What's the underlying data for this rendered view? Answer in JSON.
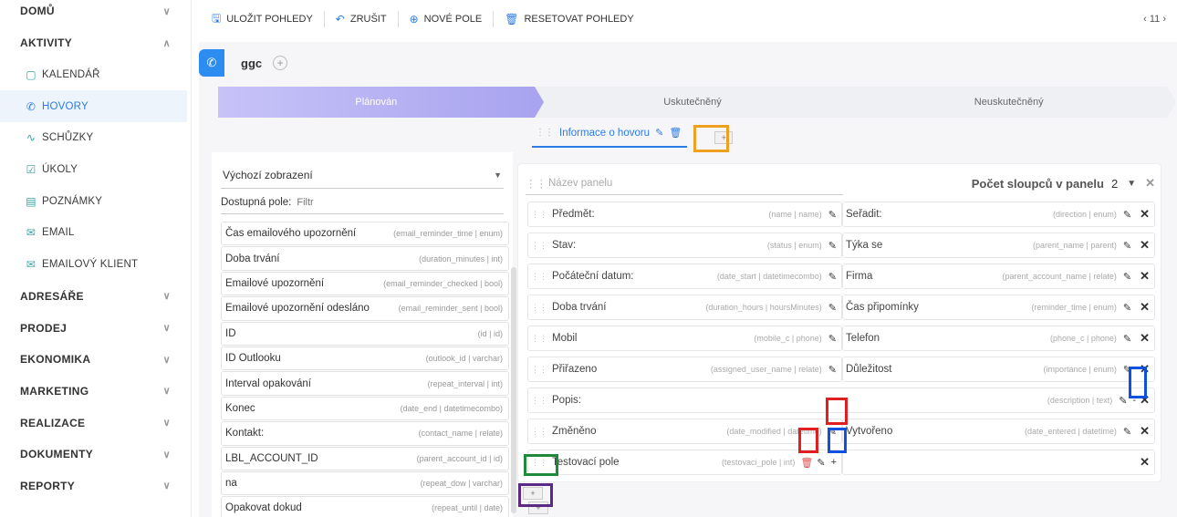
{
  "sidebar": {
    "sections": [
      {
        "label": "DOMŮ",
        "chevron": "chevron-down-icon"
      },
      {
        "label": "AKTIVITY",
        "chevron": "chevron-up-icon"
      }
    ],
    "items": [
      {
        "label": "KALENDÁŘ",
        "icon": "calendar-icon"
      },
      {
        "label": "HOVORY",
        "icon": "phone-icon"
      },
      {
        "label": "SCHŮZKY",
        "icon": "people-icon"
      },
      {
        "label": "ÚKOLY",
        "icon": "task-icon"
      },
      {
        "label": "POZNÁMKY",
        "icon": "note-icon"
      },
      {
        "label": "EMAIL",
        "icon": "mail-icon"
      },
      {
        "label": "EMAILOVÝ KLIENT",
        "icon": "mail-client-icon"
      }
    ],
    "bottom_sections": [
      {
        "label": "ADRESÁŘE"
      },
      {
        "label": "PRODEJ"
      },
      {
        "label": "EKONOMIKA"
      },
      {
        "label": "MARKETING"
      },
      {
        "label": "REALIZACE"
      },
      {
        "label": "DOKUMENTY"
      },
      {
        "label": "REPORTY"
      }
    ]
  },
  "toolbar": {
    "save_views": "ULOŽIT POHLEDY",
    "cancel": "ZRUŠIT",
    "new_field": "NOVÉ POLE",
    "reset_views": "RESETOVAT POHLEDY",
    "pager": "‹ 11 ›"
  },
  "tab": {
    "label": "ggc",
    "add": "+"
  },
  "stages": [
    "Plánován",
    "Uskutečněný",
    "Neuskutečněný"
  ],
  "panel_tab": {
    "label": "Informace o hovoru",
    "add": "+"
  },
  "left": {
    "view_select": "Výchozí zobrazení",
    "filter_label": "Dostupná pole:",
    "filter_placeholder": "Filtr",
    "fields": [
      {
        "label": "Čas emailového upozornění",
        "type": "(email_reminder_time | enum)"
      },
      {
        "label": "Doba trvání",
        "type": "(duration_minutes | int)"
      },
      {
        "label": "Emailové upozornění",
        "type": "(email_reminder_checked | bool)"
      },
      {
        "label": "Emailové upozornění odesláno",
        "type": "(email_reminder_sent | bool)"
      },
      {
        "label": "ID",
        "type": "(id | id)"
      },
      {
        "label": "ID Outlooku",
        "type": "(outlook_id | varchar)"
      },
      {
        "label": "Interval opakování",
        "type": "(repeat_interval | int)"
      },
      {
        "label": "Konec",
        "type": "(date_end | datetimecombo)"
      },
      {
        "label": "Kontakt:",
        "type": "(contact_name | relate)"
      },
      {
        "label": "LBL_ACCOUNT_ID",
        "type": "(parent_account_id | id)"
      },
      {
        "label": "na",
        "type": "(repeat_dow | varchar)"
      },
      {
        "label": "Opakovat dokud",
        "type": "(repeat_until | date)"
      }
    ]
  },
  "right": {
    "panel_name_placeholder": "Název panelu",
    "columns_label": "Počet sloupců v panelu",
    "columns_value": "2",
    "rows": [
      [
        {
          "label": "Předmět:",
          "type": "(name | name)"
        },
        {
          "label": "Seřadit:",
          "type": "(direction | enum)"
        }
      ],
      [
        {
          "label": "Stav:",
          "type": "(status | enum)"
        },
        {
          "label": "Týka se",
          "type": "(parent_name | parent)"
        }
      ],
      [
        {
          "label": "Počáteční datum:",
          "type": "(date_start | datetimecombo)"
        },
        {
          "label": "Firma",
          "type": "(parent_account_name | relate)"
        }
      ],
      [
        {
          "label": "Doba trvání",
          "type": "(duration_hours | hoursMinutes)"
        },
        {
          "label": "Čas připomínky",
          "type": "(reminder_time | enum)"
        }
      ],
      [
        {
          "label": "Mobil",
          "type": "(mobile_c | phone)"
        },
        {
          "label": "Telefon",
          "type": "(phone_c | phone)"
        }
      ],
      [
        {
          "label": "Přiřazeno",
          "type": "(assigned_user_name | relate)"
        },
        {
          "label": "Důležitost",
          "type": "(importance | enum)"
        }
      ]
    ],
    "full_row": {
      "label": "Popis:",
      "type": "(description | text)"
    },
    "row_after": [
      {
        "label": "Změněno",
        "type": "(date_modified | datetime)"
      },
      {
        "label": "Vytvořeno",
        "type": "(date_entered | datetime)"
      }
    ],
    "test_row": {
      "label": "Testovací pole",
      "type": "(testovaci_pole | int)"
    },
    "add_row": "+",
    "add_panel": "+"
  },
  "highlight_colors": {
    "orange": "#f0a020",
    "red": "#e02020",
    "blue": "#1050e0",
    "green": "#1f8a3c",
    "purple": "#5b2a86"
  }
}
